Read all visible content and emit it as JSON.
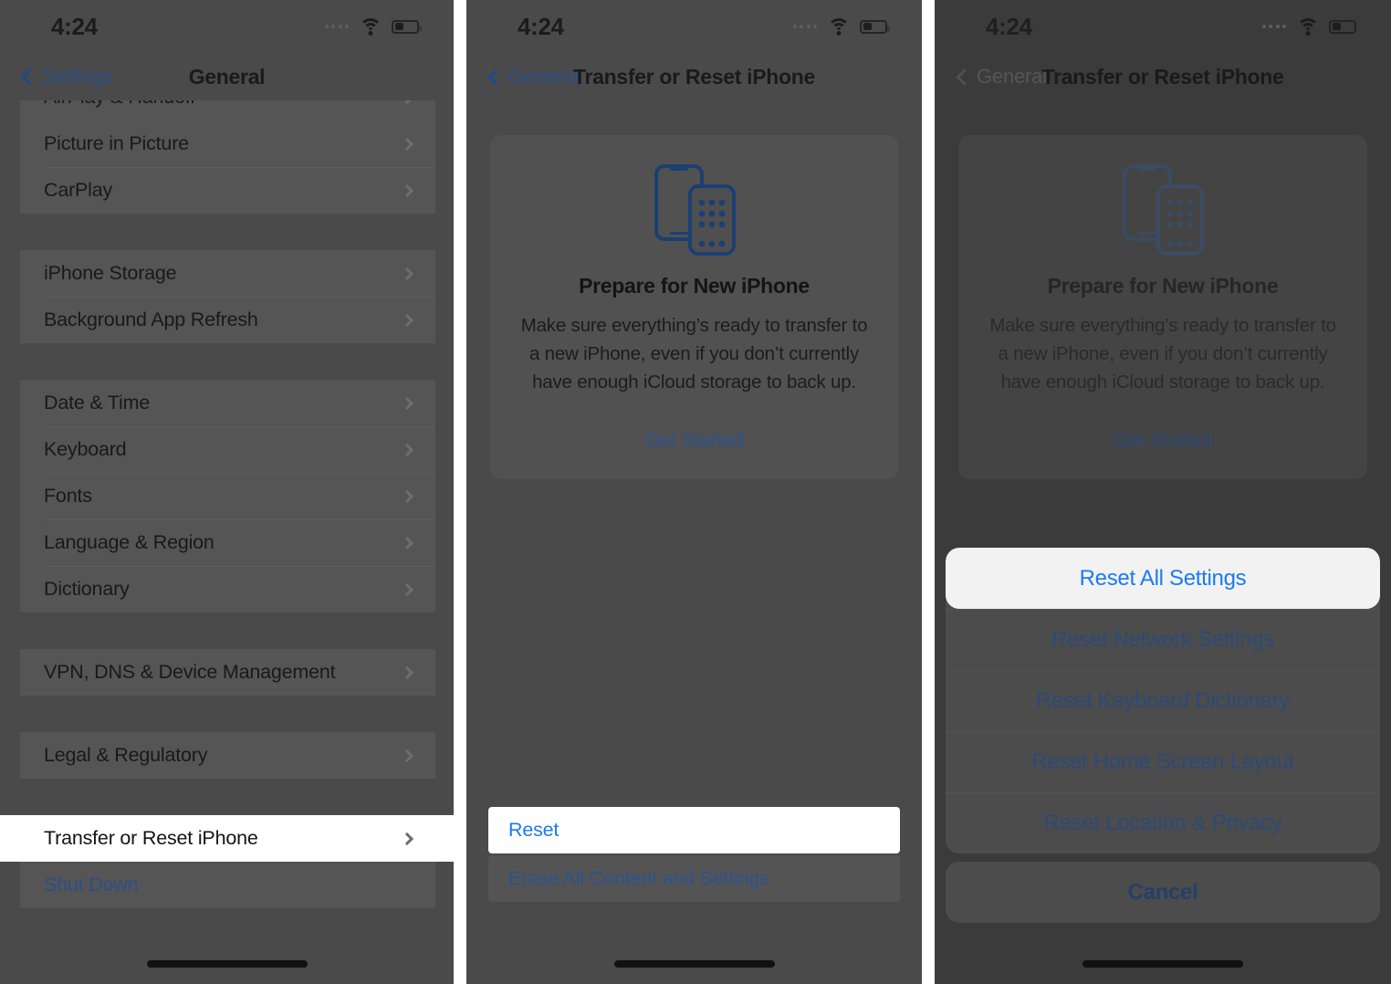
{
  "statusbar": {
    "time": "4:24",
    "icons": {
      "cellular": "cellular-dots-icon",
      "wifi": "wifi-icon",
      "battery": "battery-icon"
    },
    "battery_level_pct": 35
  },
  "panel1": {
    "nav": {
      "back_label": "Settings",
      "title": "General",
      "back_icon": "chevron-left-icon"
    },
    "clipped_row": {
      "label": "AirPlay & Handoff"
    },
    "groups": [
      {
        "rows": [
          {
            "label": "Picture in Picture",
            "accessory": "chevron-right-icon"
          },
          {
            "label": "CarPlay",
            "accessory": "chevron-right-icon"
          }
        ]
      },
      {
        "rows": [
          {
            "label": "iPhone Storage",
            "accessory": "chevron-right-icon"
          },
          {
            "label": "Background App Refresh",
            "accessory": "chevron-right-icon"
          }
        ]
      },
      {
        "rows": [
          {
            "label": "Date & Time",
            "accessory": "chevron-right-icon"
          },
          {
            "label": "Keyboard",
            "accessory": "chevron-right-icon"
          },
          {
            "label": "Fonts",
            "accessory": "chevron-right-icon"
          },
          {
            "label": "Language & Region",
            "accessory": "chevron-right-icon"
          },
          {
            "label": "Dictionary",
            "accessory": "chevron-right-icon"
          }
        ]
      },
      {
        "rows": [
          {
            "label": "VPN, DNS & Device Management",
            "accessory": "chevron-right-icon"
          }
        ]
      },
      {
        "rows": [
          {
            "label": "Legal & Regulatory",
            "accessory": "chevron-right-icon"
          }
        ]
      }
    ],
    "highlighted_row": {
      "label": "Transfer or Reset iPhone",
      "accessory": "chevron-right-icon"
    },
    "shutdown_row": {
      "label": "Shut Down"
    }
  },
  "panel2": {
    "nav": {
      "back_label": "General",
      "title": "Transfer or Reset iPhone",
      "back_icon": "chevron-left-icon"
    },
    "card": {
      "icon": "two-iphones-icon",
      "title": "Prepare for New iPhone",
      "body": "Make sure everything’s ready to transfer to a new iPhone, even if you don’t currently have enough iCloud storage to back up.",
      "link": "Get Started"
    },
    "sheet": {
      "highlighted": "Reset",
      "secondary": "Erase All Content and Settings"
    }
  },
  "panel3": {
    "nav": {
      "back_label": "General",
      "title": "Transfer or Reset iPhone",
      "back_icon": "chevron-left-icon"
    },
    "card": {
      "icon": "two-iphones-icon",
      "title": "Prepare for New iPhone",
      "body": "Make sure everything’s ready to transfer to a new iPhone, even if you don’t currently have enough iCloud storage to back up.",
      "link": "Get Started"
    },
    "action_sheet": {
      "options": [
        "Reset All Settings",
        "Reset Network Settings",
        "Reset Keyboard Dictionary",
        "Reset Home Screen Layout",
        "Reset Location & Privacy"
      ],
      "highlighted_index": 0,
      "cancel": "Cancel"
    }
  },
  "colors": {
    "accent_blue": "#1a7bf2",
    "muted_blue": "#2b5391",
    "panel_bg": "#4a4a4a",
    "dimmed_panel_bg": "#3b3b3b",
    "highlight_white": "#ffffff"
  }
}
